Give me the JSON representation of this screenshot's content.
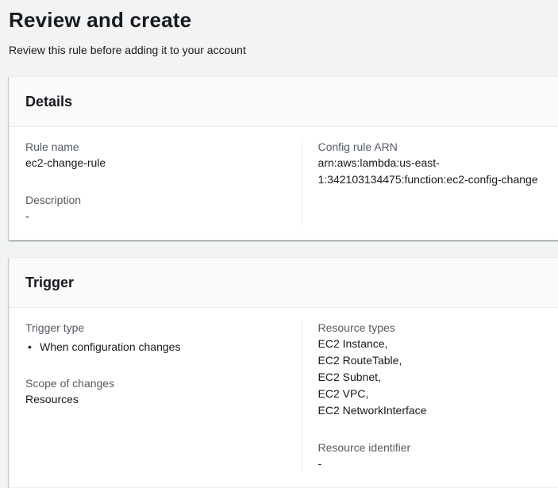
{
  "page": {
    "title": "Review and create",
    "subtitle": "Review this rule before adding it to your account"
  },
  "details": {
    "title": "Details",
    "rule_name_label": "Rule name",
    "rule_name_value": "ec2-change-rule",
    "description_label": "Description",
    "description_value": "-",
    "config_rule_arn_label": "Config rule ARN",
    "config_rule_arn_value": "arn:aws:lambda:us-east-1:342103134475:function:ec2-config-change"
  },
  "trigger": {
    "title": "Trigger",
    "trigger_type_label": "Trigger type",
    "trigger_type_values": [
      "When configuration changes"
    ],
    "scope_of_changes_label": "Scope of changes",
    "scope_of_changes_value": "Resources",
    "resource_types_label": "Resource types",
    "resource_types_values": [
      "EC2 Instance,",
      "EC2 RouteTable,",
      "EC2 Subnet,",
      "EC2 VPC,",
      "EC2 NetworkInterface"
    ],
    "resource_identifier_label": "Resource identifier",
    "resource_identifier_value": "-"
  },
  "colors": {
    "page_background": "#f2f3f3",
    "card_background": "#ffffff",
    "card_header_background": "#fafafa",
    "border": "#eaeded",
    "label_text": "#545b64",
    "value_text": "#16191f"
  }
}
